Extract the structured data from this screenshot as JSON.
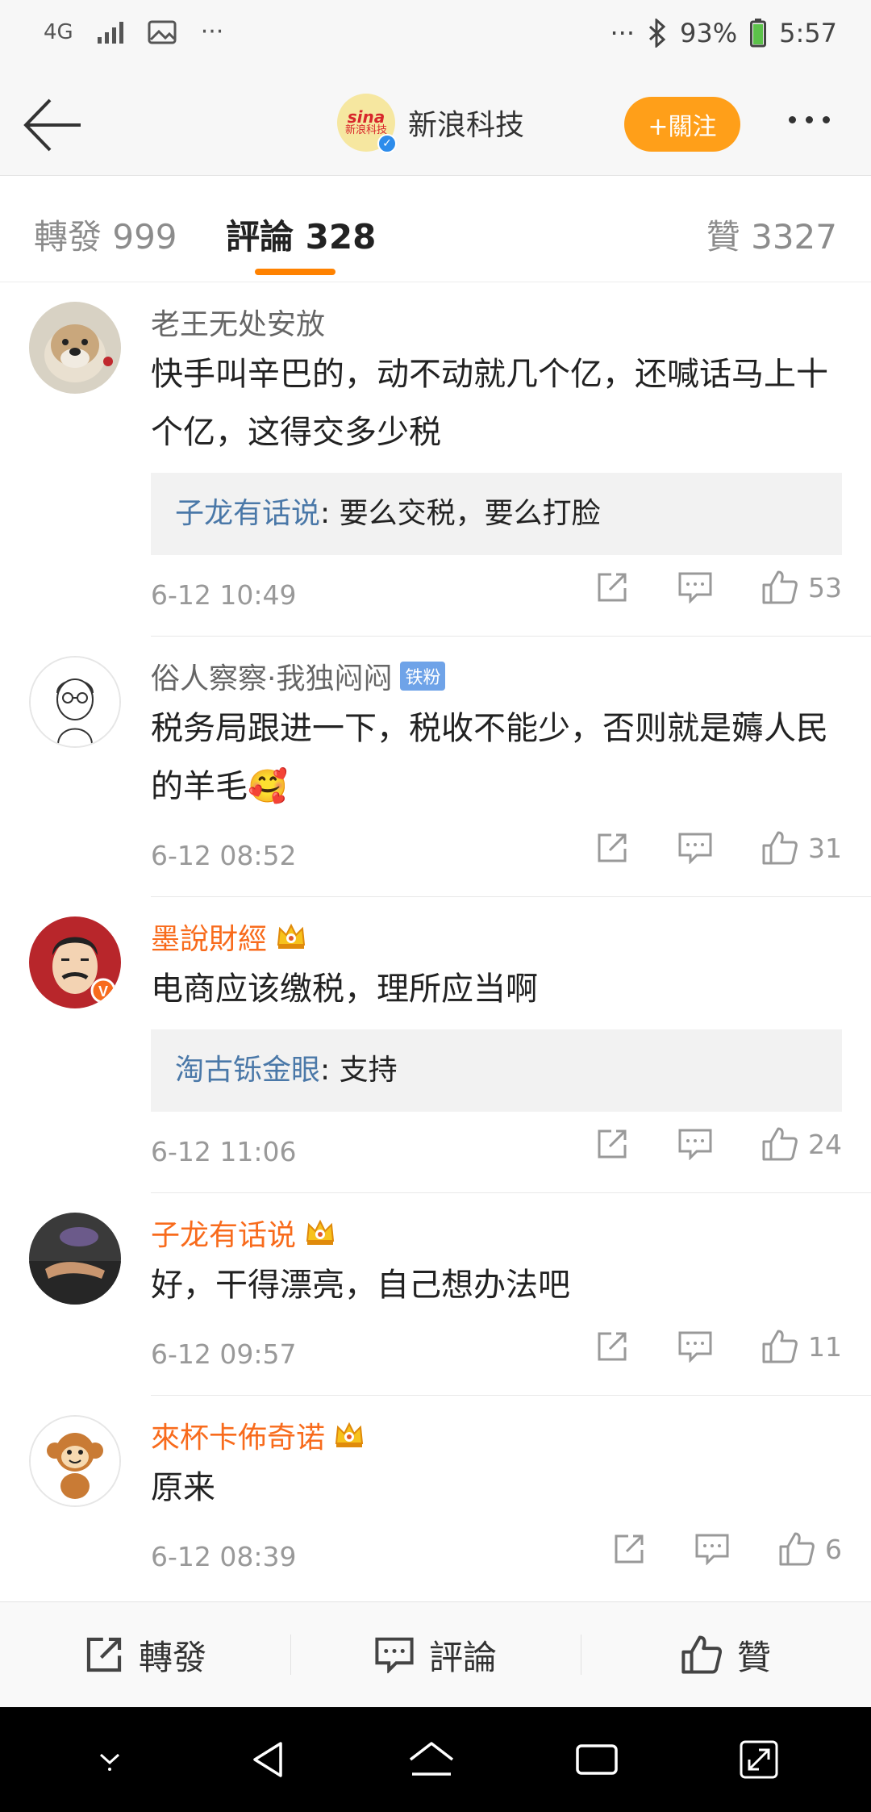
{
  "status_bar": {
    "network": "4G",
    "left_icons": [
      "signal-icon",
      "image-icon",
      "more-notifications-icon"
    ],
    "overflow": "···",
    "battery": "93%",
    "time": "5:57"
  },
  "nav": {
    "title": "新浪科技",
    "logo_text_1": "sina",
    "logo_text_2": "新浪科技",
    "follow_label": "关注",
    "follow_full": "+關注"
  },
  "tabs": {
    "repost": "轉發 999",
    "comments": "評論 328",
    "likes": "贊 3327",
    "active": "comments"
  },
  "comments": [
    {
      "author": "老王无处安放",
      "vip": false,
      "text": "快手叫辛巴的，动不动就几个亿，还喊话马上十个亿，这得交多少税",
      "reply": {
        "name": "子龙有话说",
        "text": ": 要么交税，要么打脸"
      },
      "time": "6-12 10:49",
      "likes": "53"
    },
    {
      "author": "俗人察察·我独闷闷",
      "badge": "铁粉",
      "vip": false,
      "text": "税务局跟进一下，税收不能少，否则就是薅人民的羊毛🥰",
      "time": "6-12 08:52",
      "likes": "31"
    },
    {
      "author": "墨說財經",
      "vip": true,
      "text": "电商应该缴税，理所应当啊",
      "reply": {
        "name": "淘古铄金眼",
        "text": ": 支持"
      },
      "time": "6-12 11:06",
      "likes": "24"
    },
    {
      "author": "子龙有话说",
      "vip": true,
      "text": "好，干得漂亮，自己想办法吧",
      "time": "6-12 09:57",
      "likes": "11"
    },
    {
      "author": "來杯卡佈奇诺",
      "vip": true,
      "text": "原来",
      "time": "6-12 08:39",
      "likes": "6"
    }
  ],
  "toolbar": {
    "repost": "轉發",
    "comment": "評論",
    "like": "贊"
  },
  "colors": {
    "accent": "#ff8200",
    "follow": "#ff9f19",
    "vip_name": "#f86b1c",
    "reply_name": "#4a78a8"
  }
}
